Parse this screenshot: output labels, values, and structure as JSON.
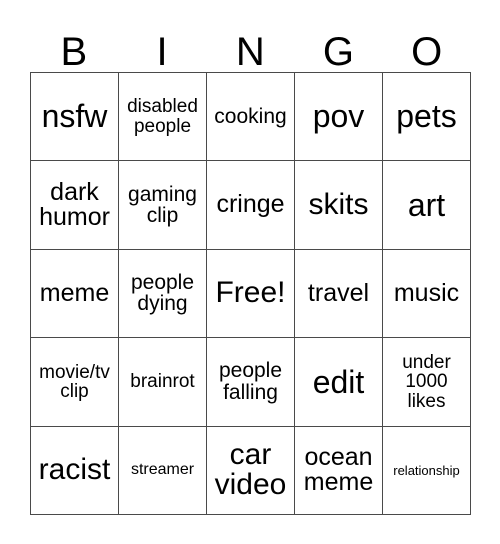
{
  "card": {
    "title": "BINGO",
    "headers": [
      "B",
      "I",
      "N",
      "G",
      "O"
    ],
    "colors": {
      "background": "#ffffff",
      "border": "#4a4a4a",
      "text": "#000000"
    },
    "grid_size": "5x5",
    "free_space": "Free!",
    "rows": [
      [
        {
          "text": "nsfw",
          "size": "fs-xl"
        },
        {
          "text": "disabled\npeople",
          "size": "fs-xs"
        },
        {
          "text": "cooking",
          "size": "fs-sm"
        },
        {
          "text": "pov",
          "size": "fs-xl"
        },
        {
          "text": "pets",
          "size": "fs-xl"
        }
      ],
      [
        {
          "text": "dark\nhumor",
          "size": "fs-md"
        },
        {
          "text": "gaming\nclip",
          "size": "fs-sm"
        },
        {
          "text": "cringe",
          "size": "fs-md"
        },
        {
          "text": "skits",
          "size": "fs-lg"
        },
        {
          "text": "art",
          "size": "fs-xl"
        }
      ],
      [
        {
          "text": "meme",
          "size": "fs-md"
        },
        {
          "text": "people\ndying",
          "size": "fs-sm"
        },
        {
          "text": "Free!",
          "size": "fs-lg"
        },
        {
          "text": "travel",
          "size": "fs-md"
        },
        {
          "text": "music",
          "size": "fs-md"
        }
      ],
      [
        {
          "text": "movie/tv\nclip",
          "size": "fs-xs"
        },
        {
          "text": "brainrot",
          "size": "fs-xs"
        },
        {
          "text": "people\nfalling",
          "size": "fs-sm"
        },
        {
          "text": "edit",
          "size": "fs-xl"
        },
        {
          "text": "under\n1000\nlikes",
          "size": "fs-xs"
        }
      ],
      [
        {
          "text": "racist",
          "size": "fs-lg"
        },
        {
          "text": "streamer",
          "size": "fs-xxs"
        },
        {
          "text": "car\nvideo",
          "size": "fs-lg"
        },
        {
          "text": "ocean\nmeme",
          "size": "fs-md"
        },
        {
          "text": "relationship",
          "size": "fs-tiny"
        }
      ]
    ]
  }
}
